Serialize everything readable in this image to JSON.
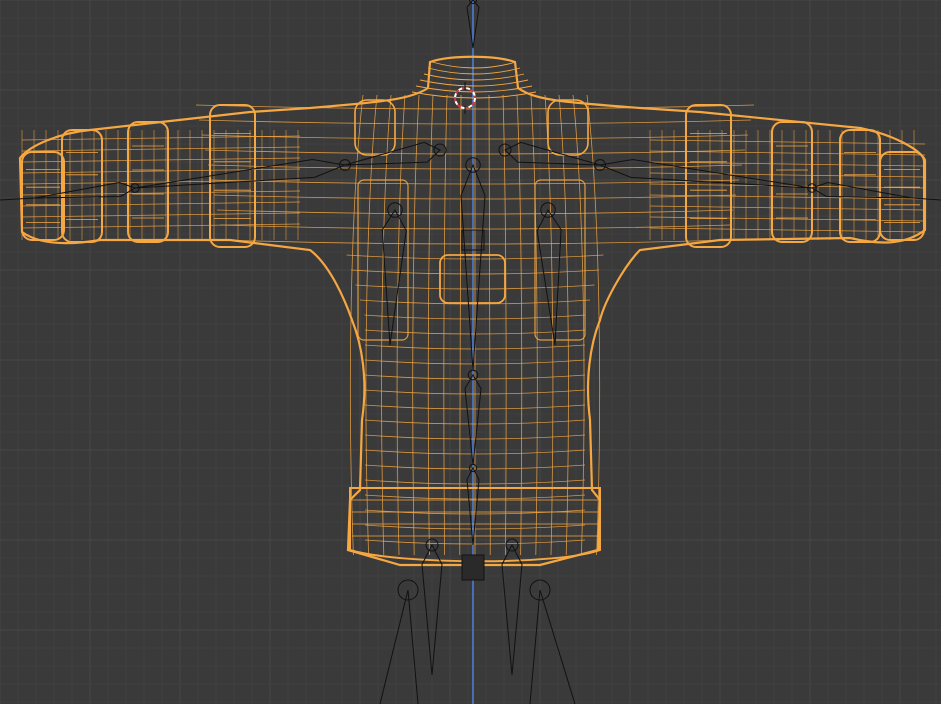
{
  "viewport": {
    "background": "#393939",
    "grid_color": "#474747",
    "grid_minor_color": "#404040"
  },
  "colors": {
    "mesh_wire": "#f5a742",
    "mesh_wire_dim": "#c98a2e",
    "armature_line": "#111111",
    "z_axis": "#4d7fe0",
    "origin_ring": "#d03a3a",
    "origin_dash": "#ffffff"
  },
  "objects": {
    "mesh_name": "",
    "armature_name": ""
  },
  "icons": {
    "scene_origin": "3d-cursor-icon",
    "object_origin": "origin-point-icon"
  }
}
